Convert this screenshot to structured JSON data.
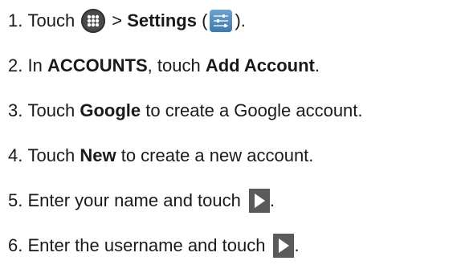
{
  "steps": [
    {
      "number": "1.",
      "text_before": "Touch",
      "icon1": "apps-grid-icon",
      "separator": ">",
      "bold": "Settings",
      "paren_open": "(",
      "icon2": "settings-sliders-icon",
      "paren_close": ")."
    },
    {
      "number": "2.",
      "text_a": "In",
      "bold_a": "ACCOUNTS",
      "text_b": ", touch",
      "bold_b": "Add Account",
      "text_c": "."
    },
    {
      "number": "3.",
      "text_a": "Touch",
      "bold_a": "Google",
      "text_b": "to create a Google account."
    },
    {
      "number": "4.",
      "text_a": "Touch",
      "bold_a": "New",
      "text_b": "to create a new account."
    },
    {
      "number": "5.",
      "text_a": "Enter your name and touch",
      "icon": "next-arrow-icon",
      "text_b": "."
    },
    {
      "number": "6.",
      "text_a": "Enter the username and touch",
      "icon": "next-arrow-icon",
      "text_b": "."
    }
  ]
}
